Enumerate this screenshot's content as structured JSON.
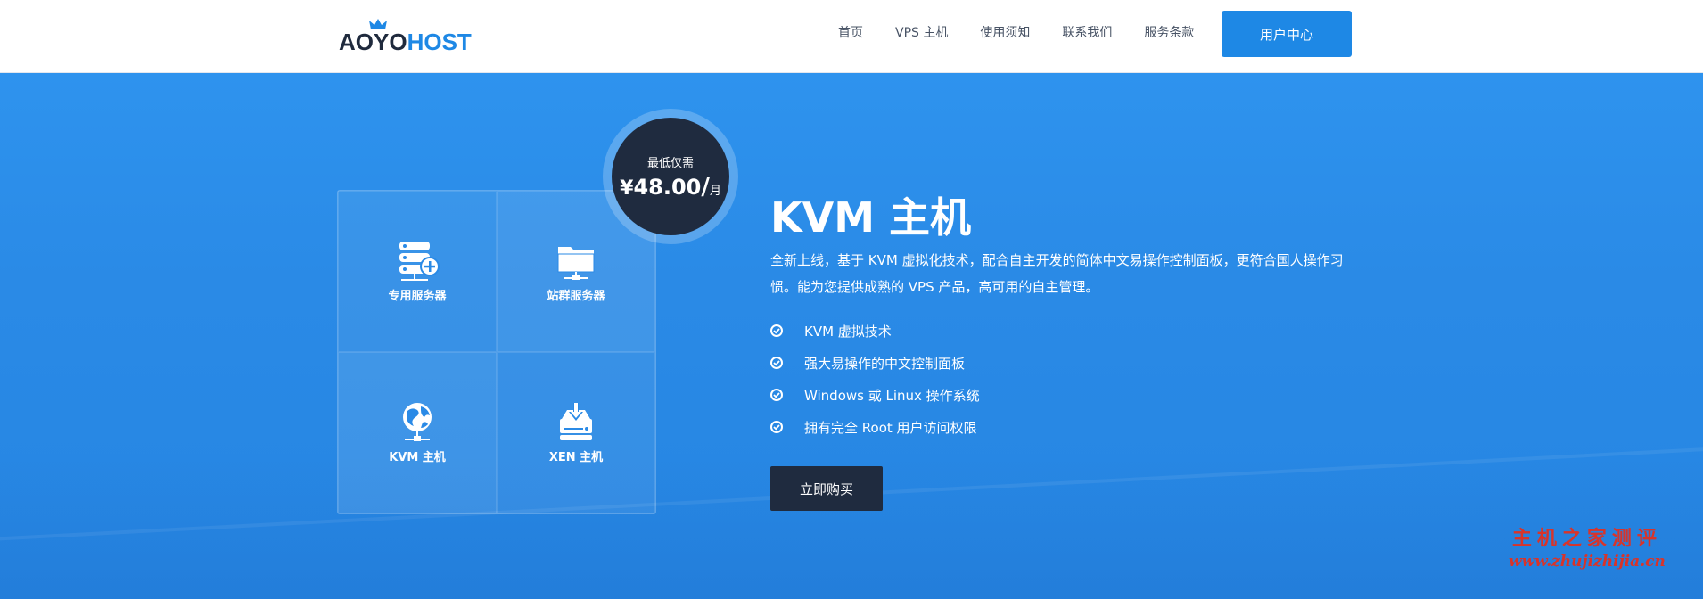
{
  "header": {
    "logo": {
      "part1": "AOYO",
      "part2": "HOST"
    },
    "nav": [
      "首页",
      "VPS 主机",
      "使用须知",
      "联系我们",
      "服务条款"
    ],
    "user_center": "用户中心"
  },
  "hero": {
    "grid": [
      {
        "label": "专用服务器",
        "icon": "server-plus-icon"
      },
      {
        "label": "站群服务器",
        "icon": "folder-network-icon"
      },
      {
        "label": "KVM 主机",
        "icon": "globe-network-icon"
      },
      {
        "label": "XEN 主机",
        "icon": "drive-download-icon"
      }
    ],
    "badge": {
      "label": "最低仅需",
      "currency": "¥",
      "amount": "48.00",
      "slash": "/",
      "unit": "月"
    },
    "title": "KVM 主机",
    "description": "全新上线，基于 KVM 虚拟化技术，配合自主开发的简体中文易操作控制面板，更符合国人操作习惯。能为您提供成熟的 VPS 产品，高可用的自主管理。",
    "features": [
      "KVM 虚拟技术",
      "强大易操作的中文控制面板",
      "Windows 或 Linux 操作系统",
      "拥有完全 Root 用户访问权限"
    ],
    "buy_button": "立即购买"
  },
  "watermark": {
    "line1": "主机之家测评",
    "line2": "www.zhujizhijia.cn"
  },
  "colors": {
    "accent": "#1e88e5",
    "dark": "#1f2b3f",
    "hero": "#2a8ae6"
  }
}
